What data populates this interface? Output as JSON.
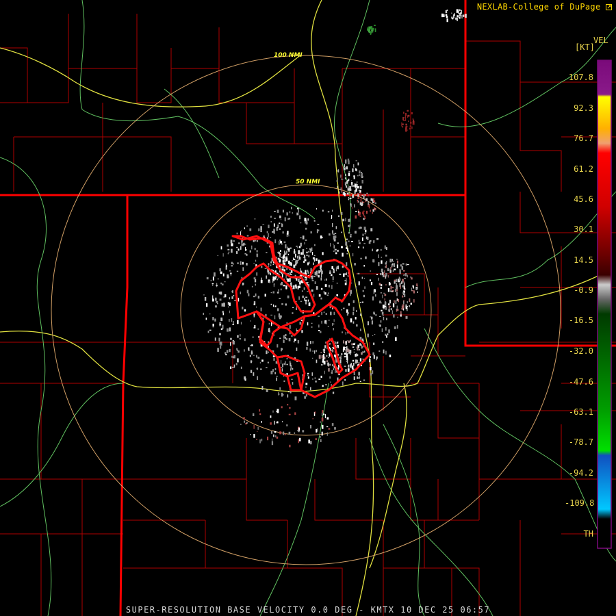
{
  "credit": "NEXLAB-College of DuPage",
  "product": {
    "legend_title": "VEL",
    "unit": "[KT]",
    "footer": "SUPER-RESOLUTION BASE VELOCITY 0.0 DEG - KMTX 10 DEC 25 06:57"
  },
  "range_rings": [
    {
      "label": "100 NMI"
    },
    {
      "label": "50 NMI"
    }
  ],
  "legend": {
    "labels": [
      "107.8",
      "92.3",
      "76.7",
      "61.2",
      "45.6",
      "30.1",
      "14.5",
      "-0.9",
      "-16.5",
      "-32.0",
      "-47.6",
      "-63.1",
      "-78.7",
      "-94.2",
      "-109.8",
      "TH"
    ],
    "colors": {
      "purple": "#7a0a7a",
      "yellow": "#ffff00",
      "salmon": "#f0a070",
      "red": "#ff0000",
      "dark_red": "#5a0000",
      "gray": "#aaaaaa",
      "dark_green": "#004a00",
      "green": "#00e000",
      "blue": "#1050c0",
      "cyan": "#00c8ff"
    }
  },
  "map_colors": {
    "county_lines": "#b00000",
    "state_lines": "#ff0000",
    "warning_polygon": "#ff1010",
    "highways": "#e0e040",
    "roads": "#60c060",
    "range_rings": "#e8b070"
  }
}
